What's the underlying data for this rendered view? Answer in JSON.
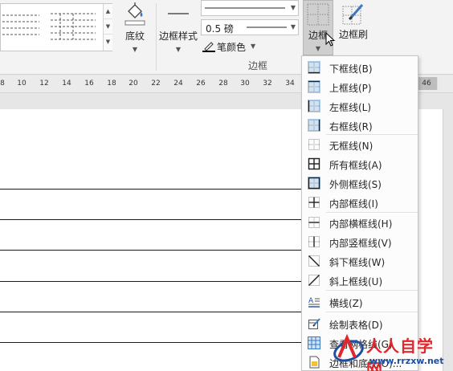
{
  "ribbon": {
    "shading_label": "底纹",
    "border_styles_label": "边框样式",
    "line_weight_value": "0.5 磅",
    "pen_color_label": "笔颜色",
    "borders_label": "边框",
    "border_painter_label": "边框刷",
    "group_label": "边框"
  },
  "ruler": {
    "ticks": [
      "8",
      "10",
      "12",
      "14",
      "16",
      "18",
      "20",
      "22",
      "24",
      "26",
      "28",
      "30",
      "32",
      "34",
      "46"
    ]
  },
  "menu": {
    "items": [
      {
        "label": "下框线(B)",
        "icon": "bottom-border-icon"
      },
      {
        "label": "上框线(P)",
        "icon": "top-border-icon"
      },
      {
        "label": "左框线(L)",
        "icon": "left-border-icon"
      },
      {
        "label": "右框线(R)",
        "icon": "right-border-icon"
      },
      {
        "label": "无框线(N)",
        "icon": "no-border-icon"
      },
      {
        "label": "所有框线(A)",
        "icon": "all-borders-icon"
      },
      {
        "label": "外侧框线(S)",
        "icon": "outside-borders-icon"
      },
      {
        "label": "内部框线(I)",
        "icon": "inside-borders-icon"
      },
      {
        "label": "内部横框线(H)",
        "icon": "inside-horizontal-border-icon"
      },
      {
        "label": "内部竖框线(V)",
        "icon": "inside-vertical-border-icon"
      },
      {
        "label": "斜下框线(W)",
        "icon": "diagonal-down-border-icon"
      },
      {
        "label": "斜上框线(U)",
        "icon": "diagonal-up-border-icon"
      },
      {
        "label": "横线(Z)",
        "icon": "horizontal-line-icon"
      },
      {
        "label": "绘制表格(D)",
        "icon": "draw-table-icon"
      },
      {
        "label": "查看网格线(G)",
        "icon": "view-gridlines-icon"
      },
      {
        "label": "边框和底纹(O)...",
        "icon": "borders-shading-icon"
      }
    ]
  },
  "watermark": {
    "brand": "人人自学网",
    "url": "www.rrzxw.net"
  },
  "colors": {
    "ribbon_bg": "#f3f3f3",
    "selected_button": "#cfcfcf",
    "menu_bg": "#fcfcfc",
    "watermark_red": "#e1262c",
    "watermark_blue": "#1d4fa0"
  }
}
